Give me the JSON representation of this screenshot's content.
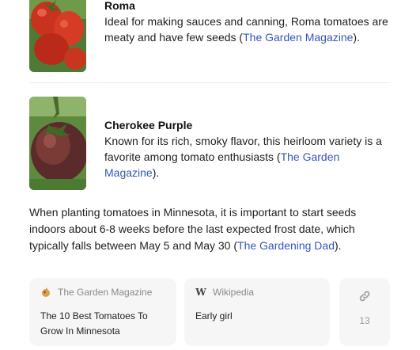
{
  "varieties": [
    {
      "name": "Roma",
      "description": "Ideal for making sauces and canning, Roma tomatoes are meaty and have few seeds (",
      "link": "The Garden Magazine",
      "after": ")."
    },
    {
      "name": "Cherokee Purple",
      "description": "Known for its rich, smoky flavor, this heirloom variety is a favorite among tomato enthusiasts (",
      "link": "The Garden Magazine",
      "after": ")."
    }
  ],
  "paragraph": {
    "text": "When planting tomatoes in Minnesota, it is important to start seeds indoors about 6-8 weeks before the last expected frost date, which typically falls between May 5 and May 30 (",
    "link": "The Gardening Dad",
    "after": ")."
  },
  "sources": [
    {
      "site": "The Garden Magazine",
      "title": "The 10 Best Tomatoes To Grow In Minnesota",
      "icon": "garden-magazine-icon"
    },
    {
      "site": "Wikipedia",
      "title": "Early girl",
      "icon": "wikipedia-icon",
      "icon_glyph": "W"
    }
  ],
  "more_sources": {
    "count": "13",
    "icon": "link-icon"
  },
  "colors": {
    "link": "#3558b8",
    "card_bg": "#f6f6f7",
    "muted": "#8a8a8a"
  }
}
